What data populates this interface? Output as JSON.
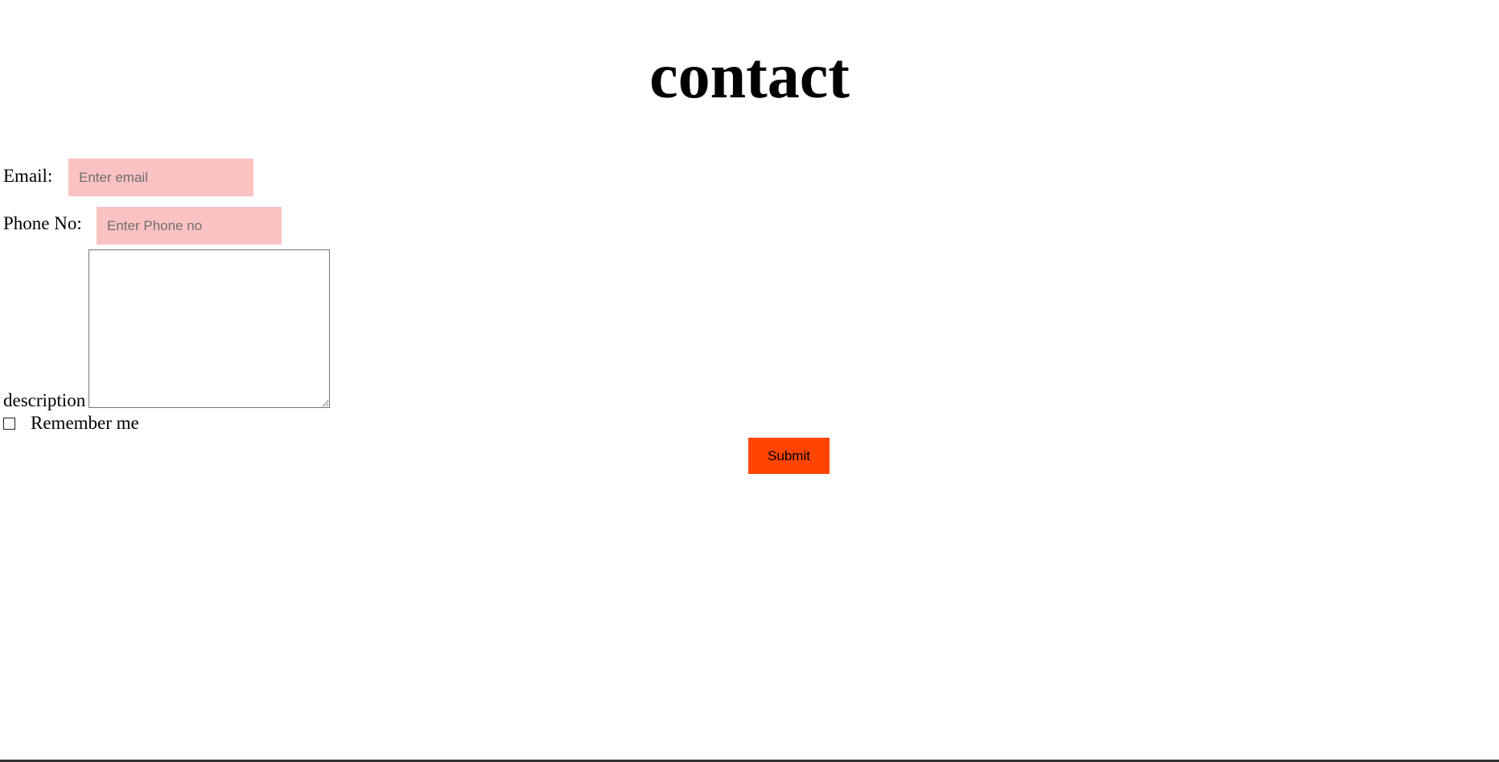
{
  "page": {
    "title": "contact"
  },
  "form": {
    "email": {
      "label": "Email:",
      "placeholder": "Enter email",
      "value": ""
    },
    "phone": {
      "label": "Phone No:",
      "placeholder": "Enter Phone no",
      "value": ""
    },
    "description": {
      "label": "description",
      "value": ""
    },
    "remember": {
      "label": "Remember me",
      "checked": false
    },
    "submit_label": "Submit"
  },
  "colors": {
    "input_background": "#fbc2c3",
    "submit_background": "#ff4500"
  }
}
